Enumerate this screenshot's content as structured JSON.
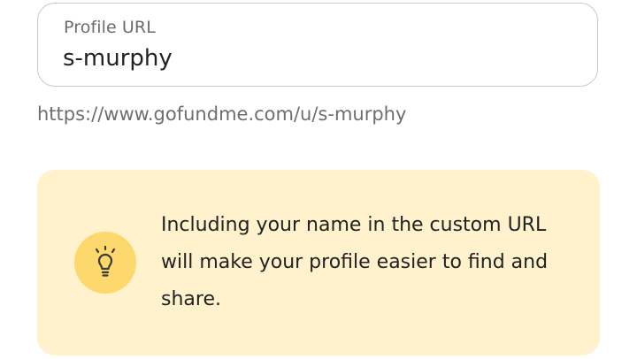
{
  "profile_url_field": {
    "label": "Profile URL",
    "value": "s-murphy"
  },
  "url_preview": "https://www.gofundme.com/u/s-murphy",
  "tip": {
    "icon": "lightbulb-icon",
    "text": "Including your name in the custom URL will make your profile easier to find and share."
  },
  "colors": {
    "tip_background": "#fff2cc",
    "icon_circle": "#fdd86c",
    "field_border": "#c9c9c9"
  }
}
